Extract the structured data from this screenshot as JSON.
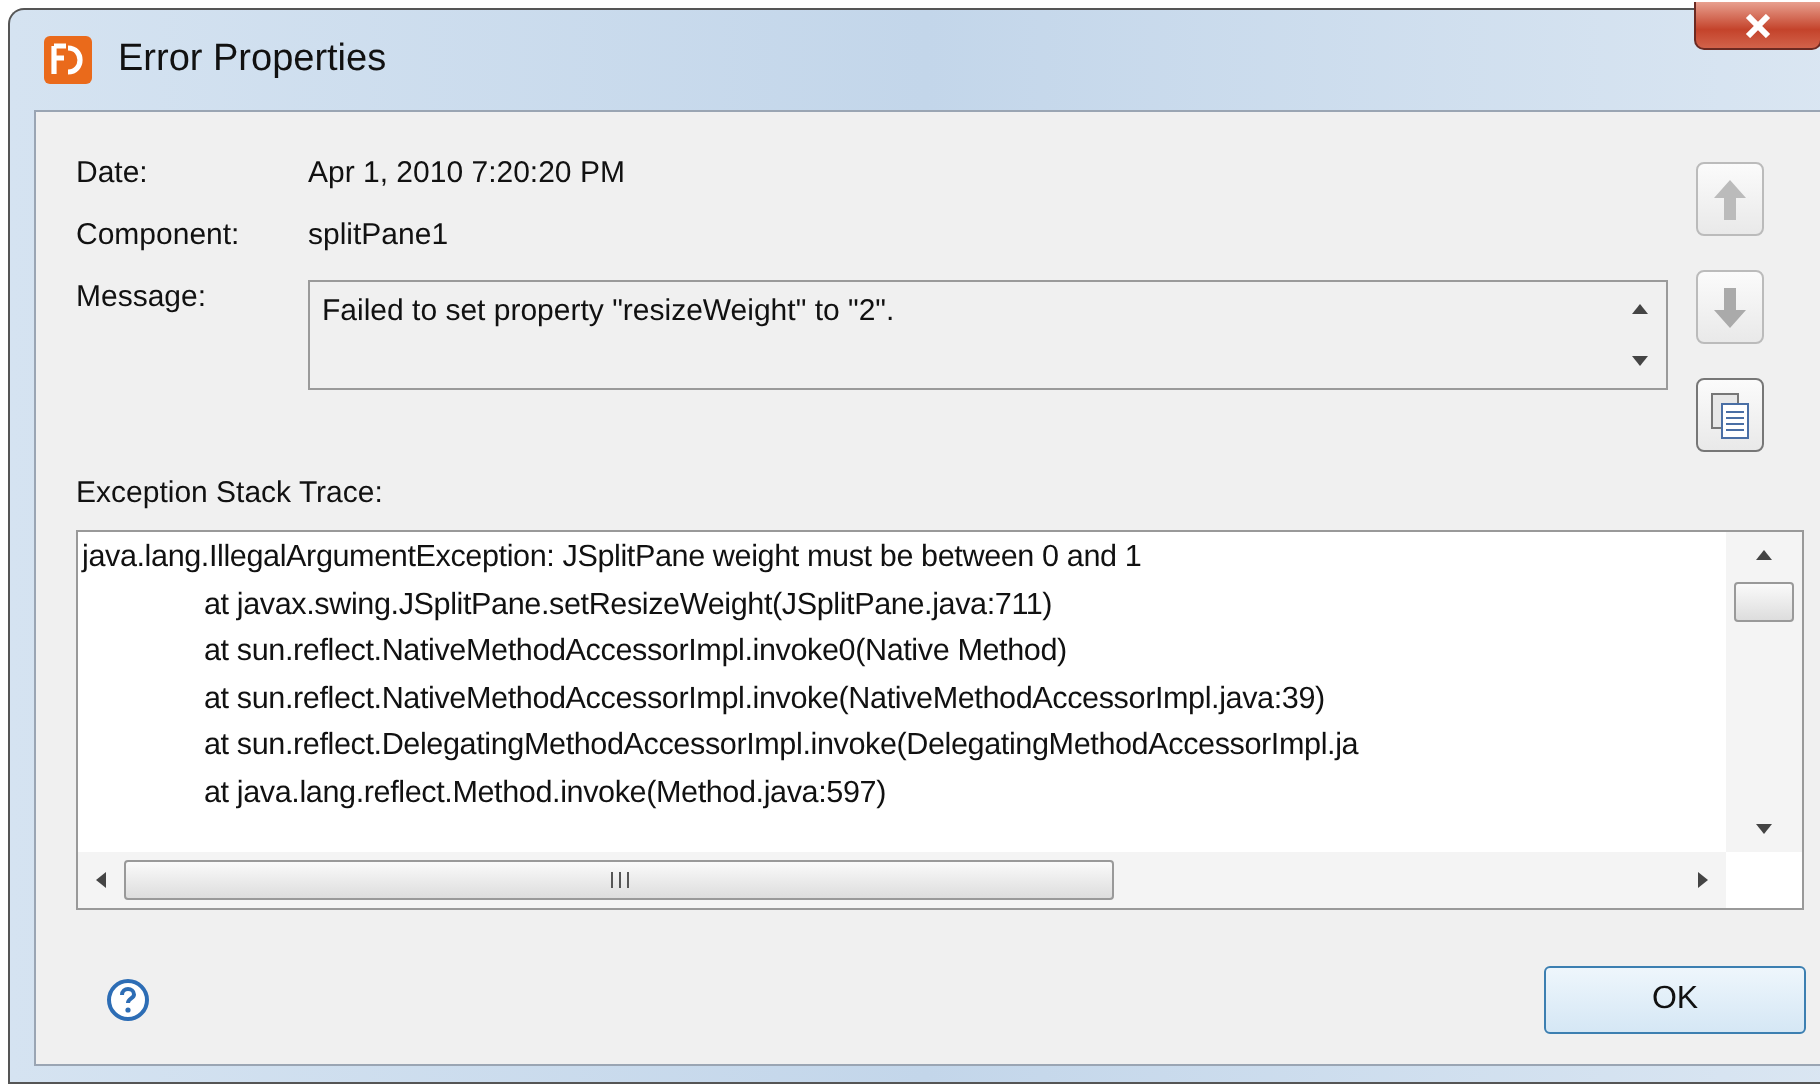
{
  "window": {
    "title": "Error Properties"
  },
  "fields": [
    {
      "label": "Date:",
      "value": "Apr 1, 2010 7:20:20 PM"
    },
    {
      "label": "Component:",
      "value": "splitPane1"
    }
  ],
  "message": {
    "label": "Message:",
    "value": "Failed to set property \"resizeWeight\" to \"2\"."
  },
  "stack_trace": {
    "label": "Exception Stack Trace:",
    "exception": "java.lang.IllegalArgumentException: JSplitPane weight must be between 0 and 1",
    "frames": [
      "at javax.swing.JSplitPane.setResizeWeight(JSplitPane.java:711)",
      "at sun.reflect.NativeMethodAccessorImpl.invoke0(Native Method)",
      "at sun.reflect.NativeMethodAccessorImpl.invoke(NativeMethodAccessorImpl.java:39)",
      "at sun.reflect.DelegatingMethodAccessorImpl.invoke(DelegatingMethodAccessorImpl.ja",
      "at java.lang.reflect.Method.invoke(Method.java:597)"
    ]
  },
  "buttons": [
    {
      "label": "OK"
    }
  ]
}
